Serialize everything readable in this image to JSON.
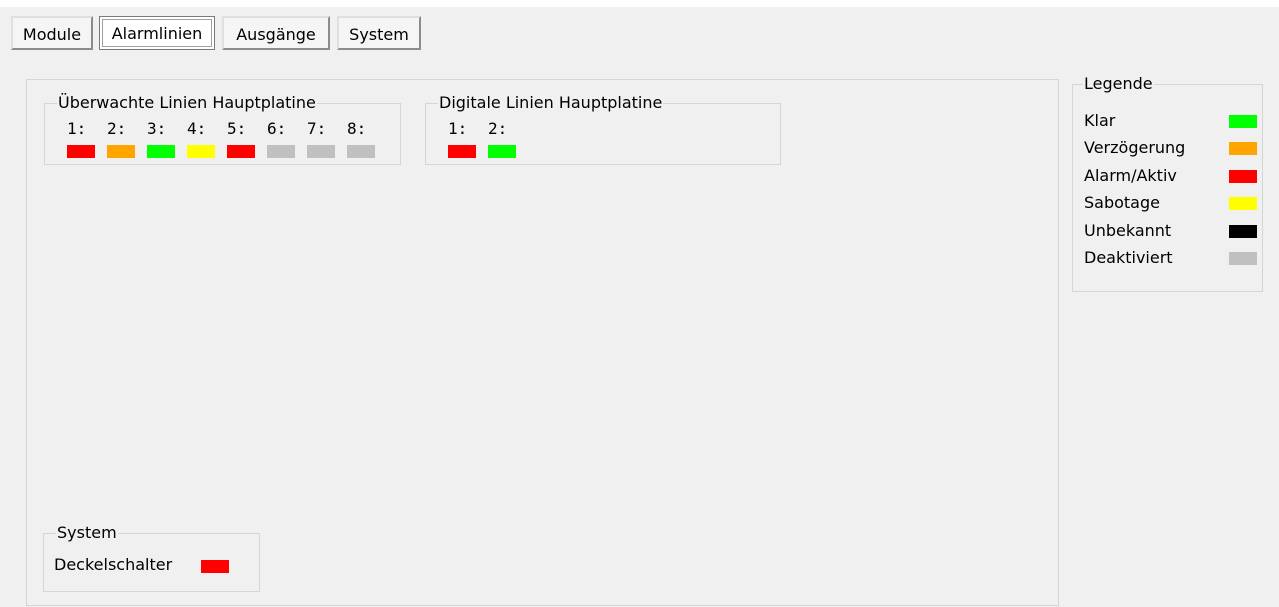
{
  "tabs": [
    {
      "label": "Module",
      "active": false
    },
    {
      "label": "Alarmlinien",
      "active": true
    },
    {
      "label": "Ausgänge",
      "active": false
    },
    {
      "label": "System",
      "active": false
    }
  ],
  "colors": {
    "green": "#00ff00",
    "orange": "#ffa500",
    "red": "#ff0000",
    "yellow": "#ffff00",
    "black": "#000000",
    "gray": "#c0c0c0"
  },
  "monitored_lines": {
    "title": "Überwachte Linien Hauptplatine",
    "items": [
      {
        "label": "1:",
        "status_color": "#ff0000"
      },
      {
        "label": "2:",
        "status_color": "#ffa500"
      },
      {
        "label": "3:",
        "status_color": "#00ff00"
      },
      {
        "label": "4:",
        "status_color": "#ffff00"
      },
      {
        "label": "5:",
        "status_color": "#ff0000"
      },
      {
        "label": "6:",
        "status_color": "#c0c0c0"
      },
      {
        "label": "7:",
        "status_color": "#c0c0c0"
      },
      {
        "label": "8:",
        "status_color": "#c0c0c0"
      }
    ]
  },
  "digital_lines": {
    "title": "Digitale Linien Hauptplatine",
    "items": [
      {
        "label": "1:",
        "status_color": "#ff0000"
      },
      {
        "label": "2:",
        "status_color": "#00ff00"
      }
    ]
  },
  "system": {
    "title": "System",
    "items": [
      {
        "label": "Deckelschalter",
        "status_color": "#ff0000"
      }
    ]
  },
  "legend": {
    "title": "Legende",
    "items": [
      {
        "label": "Klar",
        "color": "#00ff00"
      },
      {
        "label": "Verzögerung",
        "color": "#ffa500"
      },
      {
        "label": "Alarm/Aktiv",
        "color": "#ff0000"
      },
      {
        "label": "Sabotage",
        "color": "#ffff00"
      },
      {
        "label": "Unbekannt",
        "color": "#000000"
      },
      {
        "label": "Deaktiviert",
        "color": "#c0c0c0"
      }
    ]
  }
}
